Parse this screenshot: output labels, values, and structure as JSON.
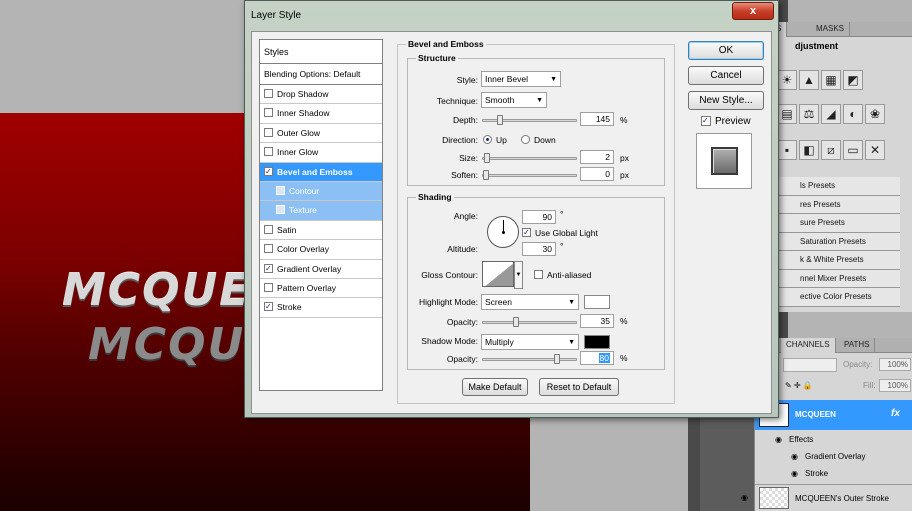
{
  "dialog": {
    "title": "Layer Style",
    "close_label": "x",
    "styles_header": "Styles",
    "blending_options": "Blending Options: Default",
    "effects": [
      {
        "label": "Drop Shadow",
        "checked": false
      },
      {
        "label": "Inner Shadow",
        "checked": false
      },
      {
        "label": "Outer Glow",
        "checked": false
      },
      {
        "label": "Inner Glow",
        "checked": false
      },
      {
        "label": "Bevel and Emboss",
        "checked": true,
        "selected": true
      },
      {
        "label": "Contour",
        "checked": false,
        "sub": true
      },
      {
        "label": "Texture",
        "checked": false,
        "sub": true
      },
      {
        "label": "Satin",
        "checked": false
      },
      {
        "label": "Color Overlay",
        "checked": false
      },
      {
        "label": "Gradient Overlay",
        "checked": true
      },
      {
        "label": "Pattern Overlay",
        "checked": false
      },
      {
        "label": "Stroke",
        "checked": true
      }
    ],
    "section_title": "Bevel and Emboss",
    "structure": {
      "title": "Structure",
      "style_label": "Style:",
      "style_value": "Inner Bevel",
      "technique_label": "Technique:",
      "technique_value": "Smooth",
      "depth_label": "Depth:",
      "depth_value": "145",
      "depth_unit": "%",
      "direction_label": "Direction:",
      "direction_up": "Up",
      "direction_down": "Down",
      "size_label": "Size:",
      "size_value": "2",
      "size_unit": "px",
      "soften_label": "Soften:",
      "soften_value": "0",
      "soften_unit": "px"
    },
    "shading": {
      "title": "Shading",
      "angle_label": "Angle:",
      "angle_value": "90",
      "angle_unit": "°",
      "global_light_label": "Use Global Light",
      "global_light_checked": true,
      "altitude_label": "Altitude:",
      "altitude_value": "30",
      "altitude_unit": "°",
      "gloss_label": "Gloss Contour:",
      "anti_aliased_label": "Anti-aliased",
      "highlight_mode_label": "Highlight Mode:",
      "highlight_mode_value": "Screen",
      "highlight_color": "#ffffff",
      "highlight_opacity_label": "Opacity:",
      "highlight_opacity_value": "35",
      "highlight_opacity_unit": "%",
      "shadow_mode_label": "Shadow Mode:",
      "shadow_mode_value": "Multiply",
      "shadow_color": "#000000",
      "shadow_opacity_label": "Opacity:",
      "shadow_opacity_value": "80",
      "shadow_opacity_unit": "%"
    },
    "make_default_label": "Make Default",
    "reset_default_label": "Reset to Default",
    "ok_label": "OK",
    "cancel_label": "Cancel",
    "new_style_label": "New Style...",
    "preview_label": "Preview",
    "preview_checked": true
  },
  "canvas": {
    "text_top": "MCQUEEN",
    "text_bottom": "MCQUEEN"
  },
  "adjustments_panel": {
    "tabs": [
      "ENTS",
      "MASKS"
    ],
    "title": "djustment",
    "presets": [
      "ls Presets",
      "res Presets",
      "sure Presets",
      "Saturation Presets",
      "k & White Presets",
      "nnel Mixer Presets",
      "ective Color Presets"
    ]
  },
  "layers_panel": {
    "tabs": [
      "CHANNELS",
      "PATHS"
    ],
    "opacity_label": "Opacity:",
    "opacity_value": "100%",
    "fill_label": "Fill:",
    "fill_value": "100%",
    "layer_name": "MCQUEEN",
    "fx_label": "fx",
    "effects_label": "Effects",
    "effect_items": [
      "Gradient Overlay",
      "Stroke"
    ],
    "layer2_name": "MCQUEEN's Outer Stroke"
  }
}
